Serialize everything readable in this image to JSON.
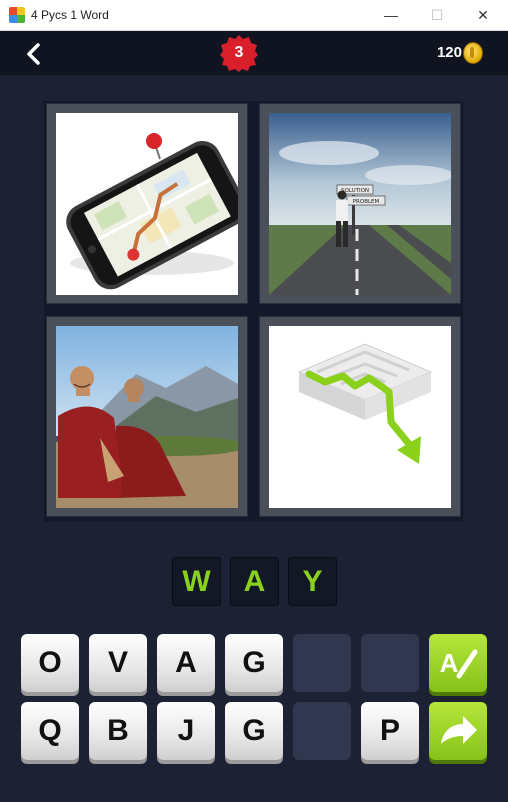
{
  "window": {
    "title": "4 Pycs 1 Word",
    "minimize": "—",
    "maximize": "☐",
    "close": "✕"
  },
  "header": {
    "level": "3",
    "coins": "120"
  },
  "pictures": [
    "map-on-smartphone",
    "man-at-road-signpost",
    "two-smiling-monks",
    "green-arrow-maze"
  ],
  "signpost": {
    "top": "SOLUTION",
    "bottom": "PROBLEM"
  },
  "answer": [
    "W",
    "A",
    "Y"
  ],
  "keyboard": {
    "row1": [
      "O",
      "V",
      "A",
      "G",
      "",
      ""
    ],
    "row2": [
      "Q",
      "B",
      "J",
      "G",
      "",
      "P"
    ]
  },
  "colors": {
    "accent_green": "#8ad11e",
    "background": "#1c2233",
    "badge_red": "#d9202a"
  }
}
